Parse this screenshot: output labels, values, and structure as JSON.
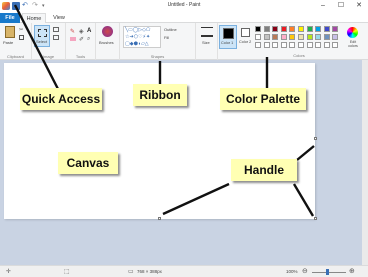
{
  "window": {
    "title": "Untitled - Paint",
    "minimize_icon": "minimize-icon",
    "maximize_icon": "maximize-icon",
    "close_icon": "close-icon"
  },
  "tabs": [
    {
      "label": "File"
    },
    {
      "label": "Home"
    },
    {
      "label": "View"
    }
  ],
  "ribbon": {
    "clipboard": {
      "paste": "Paste",
      "label": "Clipboard"
    },
    "image": {
      "select": "Select",
      "label": "Image"
    },
    "tools": {
      "label": "Tools"
    },
    "brushes": {
      "label": "Brushes"
    },
    "shapes": {
      "outline": "Outline",
      "fill": "Fill",
      "label": "Shapes"
    },
    "size": {
      "label": "Size"
    },
    "color1": {
      "label": "Color 1",
      "color": "#000000"
    },
    "color2": {
      "label": "Color 2",
      "color": "#ffffff"
    },
    "colors": {
      "label": "Colors"
    },
    "edit_colors": {
      "label": "Edit colors"
    }
  },
  "palette": [
    "#000000",
    "#7f7f7f",
    "#880015",
    "#ed1c24",
    "#ff7f27",
    "#fff200",
    "#22b14c",
    "#00a2e8",
    "#3f48cc",
    "#a349a4",
    "#ffffff",
    "#c3c3c3",
    "#b97a57",
    "#ffaec9",
    "#ffc90e",
    "#efe4b0",
    "#b5e61d",
    "#99d9ea",
    "#7092be",
    "#c8bfe7",
    "#ffffff",
    "#ffffff",
    "#ffffff",
    "#ffffff",
    "#ffffff",
    "#ffffff",
    "#ffffff",
    "#ffffff",
    "#ffffff",
    "#ffffff"
  ],
  "statusbar": {
    "dimensions": "768 × 388px",
    "zoom": "100%"
  },
  "callouts": {
    "quick_access": "Quick Access",
    "ribbon": "Ribbon",
    "color_palette": "Color Palette",
    "canvas": "Canvas",
    "handle": "Handle"
  }
}
